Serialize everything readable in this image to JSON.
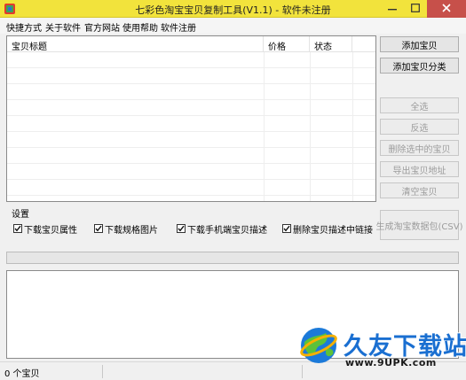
{
  "window": {
    "title": "七彩色淘宝宝贝复制工具(V1.1) - 软件未注册",
    "accent_color": "#f2e33c",
    "close_color": "#c7504a"
  },
  "menu": [
    {
      "label": "快捷方式"
    },
    {
      "label": "关于软件"
    },
    {
      "label": "官方网站"
    },
    {
      "label": "使用帮助"
    },
    {
      "label": "软件注册"
    }
  ],
  "list": {
    "columns": [
      "宝贝标题",
      "价格",
      "状态"
    ],
    "rows": []
  },
  "buttons": {
    "add_item": "添加宝贝",
    "add_category": "添加宝贝分类",
    "select_all": "全选",
    "invert": "反选",
    "delete_selected": "删除选中的宝贝",
    "export_urls": "导出宝贝地址",
    "clear": "清空宝贝",
    "generate_csv": "生成淘宝数据包(CSV)"
  },
  "settings": {
    "label": "设置",
    "options": [
      {
        "label": "下载宝贝属性",
        "checked": true
      },
      {
        "label": "下载规格图片",
        "checked": true
      },
      {
        "label": "下载手机端宝贝描述",
        "checked": true
      },
      {
        "label": "删除宝贝描述中链接",
        "checked": true
      }
    ]
  },
  "progress": {
    "percent": 0
  },
  "log": {
    "text": ""
  },
  "status": {
    "count_text": "0 个宝贝"
  },
  "watermark": {
    "brand": "久友下载站",
    "url": "www.9UPK.com"
  }
}
